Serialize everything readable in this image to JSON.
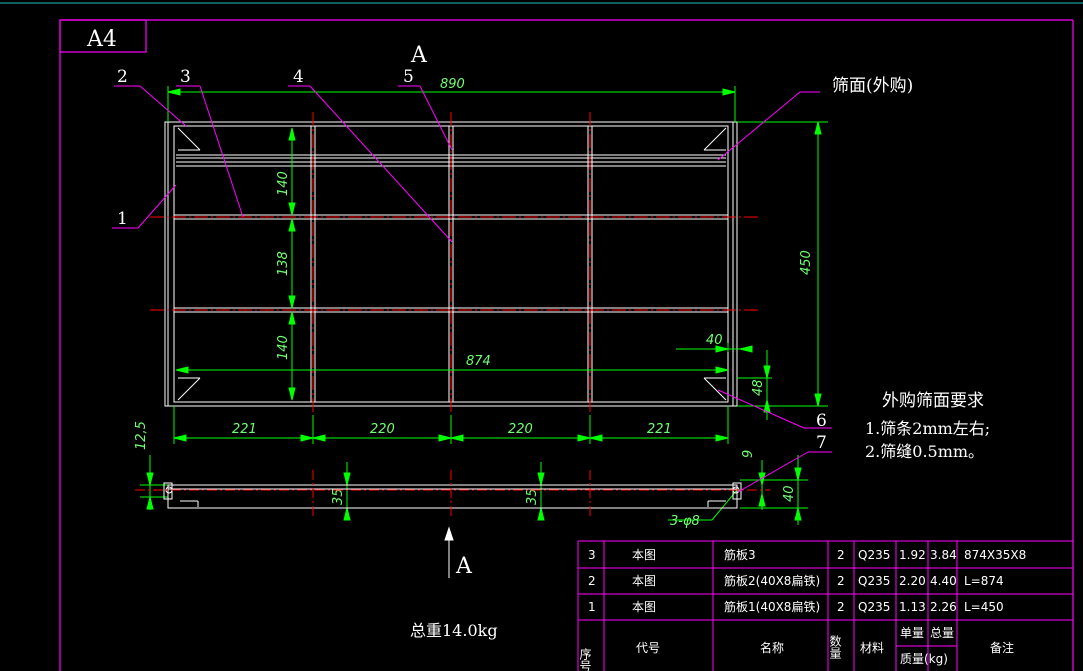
{
  "colors": {
    "background": "#000000",
    "frame": "#ff00ff",
    "geometry": "#ffffff",
    "dimension": "#00ff00",
    "centerline": "#ff0000",
    "leader": "#ff00ff"
  },
  "sheet": {
    "size_label": "A4"
  },
  "section_markers": [
    "A",
    "A"
  ],
  "part_labels": [
    "1",
    "2",
    "3",
    "4",
    "5",
    "6",
    "7"
  ],
  "screen_note": "筛面(外购)",
  "dimensions": {
    "overall_width": "890",
    "overall_height": "450",
    "inner_width": "874",
    "row_1": "140",
    "row_2": "138",
    "row_3": "140",
    "corner_w": "40",
    "corner_h": "48",
    "col_1": "221",
    "col_2": "220",
    "col_3": "220",
    "col_4": "221",
    "side_12_5": "12,5",
    "side_35_a": "35",
    "side_35_b": "35",
    "side_9": "9",
    "side_40": "40",
    "hole_spec": "3-φ8"
  },
  "requirements": {
    "title": "外购筛面要求",
    "items": [
      "1.筛条2mm左右;",
      "2.筛缝0.5mm。"
    ]
  },
  "total_weight": "总重14.0kg",
  "bom": {
    "rows": [
      [
        "3",
        "本图",
        "筋板3",
        "2",
        "Q235",
        "1.92",
        "3.84",
        "874X35X8"
      ],
      [
        "2",
        "本图",
        "筋板2(40X8扁铁)",
        "2",
        "Q235",
        "2.20",
        "4.40",
        "L=874"
      ],
      [
        "1",
        "本图",
        "筋板1(40X8扁铁)",
        "2",
        "Q235",
        "1.13",
        "2.26",
        "L=450"
      ]
    ],
    "header": {
      "seq": "序号",
      "code": "代号",
      "name": "名称",
      "qty": "数量",
      "material": "材料",
      "unit_mass": "单量",
      "total_mass": "总量",
      "mass_unit": "质量(kg)",
      "remark": "备注"
    }
  }
}
